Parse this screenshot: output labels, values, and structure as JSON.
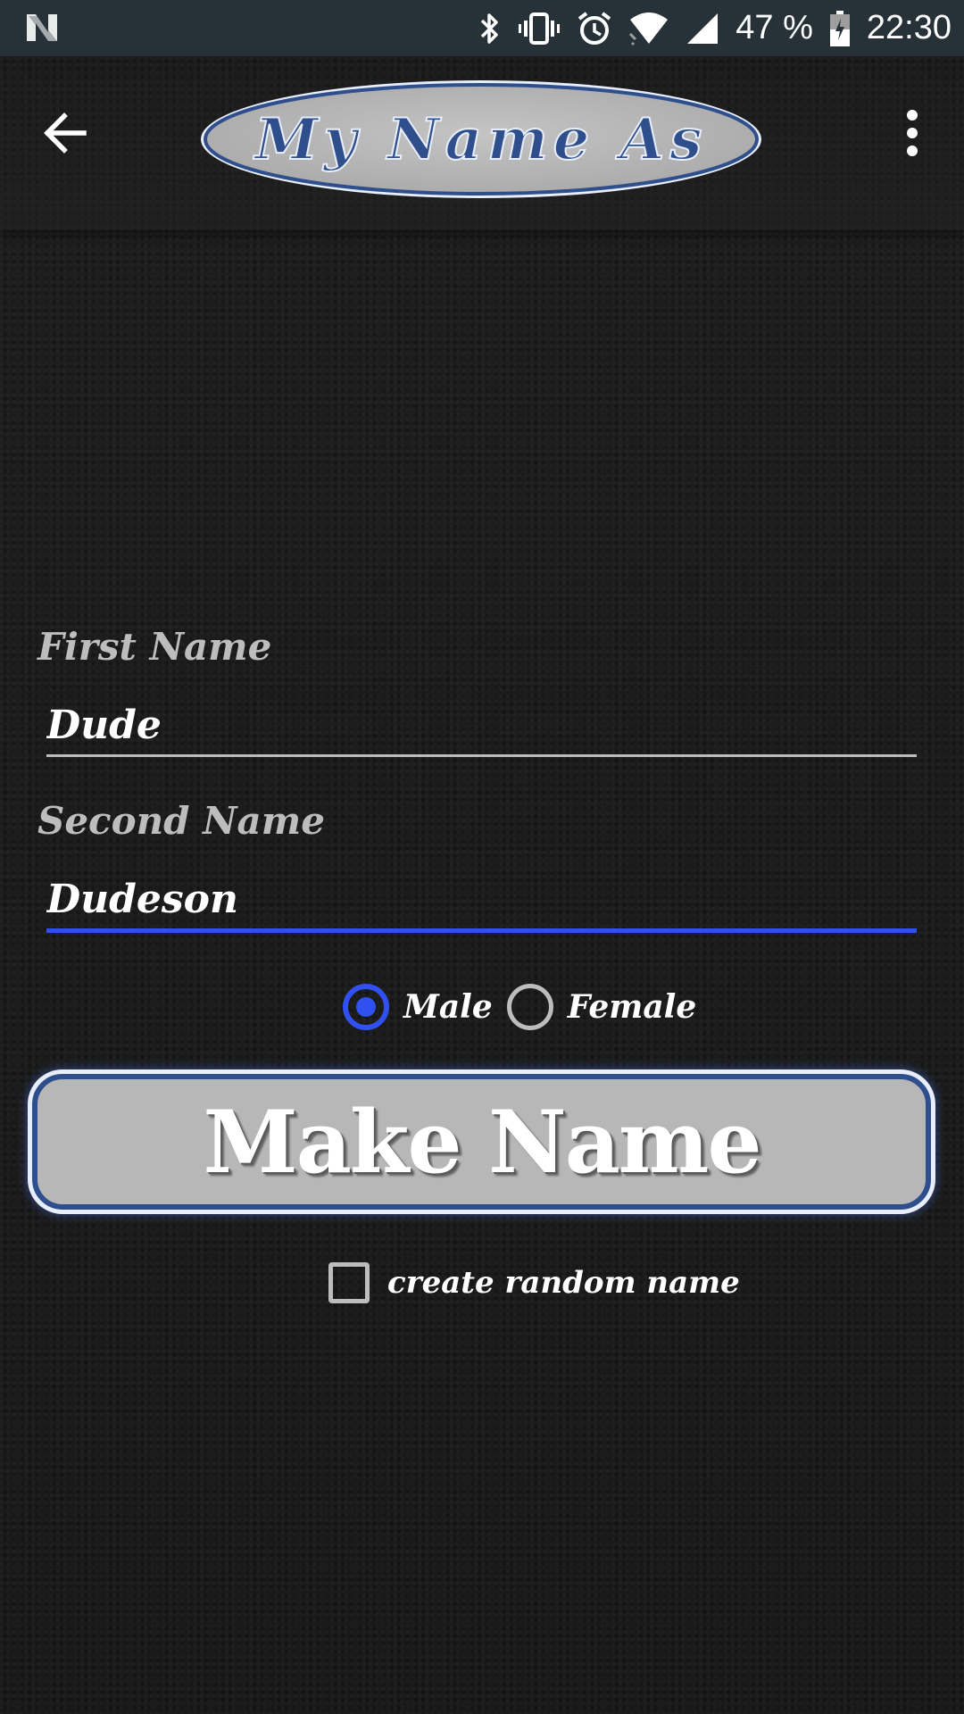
{
  "status_bar": {
    "battery": "47 %",
    "time": "22:30",
    "icons": [
      "n-notification-icon",
      "bluetooth-icon",
      "vibrate-icon",
      "alarm-icon",
      "wifi-icon",
      "signal-icon",
      "battery-icon"
    ]
  },
  "toolbar": {
    "logo_text": "My Name As",
    "back_icon": "back-arrow-icon",
    "menu_icon": "overflow-menu-icon"
  },
  "form": {
    "first_name_label": "First Name",
    "first_name_value": "Dude",
    "second_name_label": "Second Name",
    "second_name_value": "Dudeson",
    "gender_options": [
      {
        "label": "Male",
        "selected": true
      },
      {
        "label": "Female",
        "selected": false
      }
    ],
    "make_button_label": "Make Name",
    "random_checkbox_label": "create random name",
    "random_checkbox_checked": false
  },
  "colors": {
    "accent": "#3150f0",
    "status_bar_bg": "#263238",
    "logo_blue": "#2f4f8c",
    "button_gray": "#b7b7b7"
  }
}
